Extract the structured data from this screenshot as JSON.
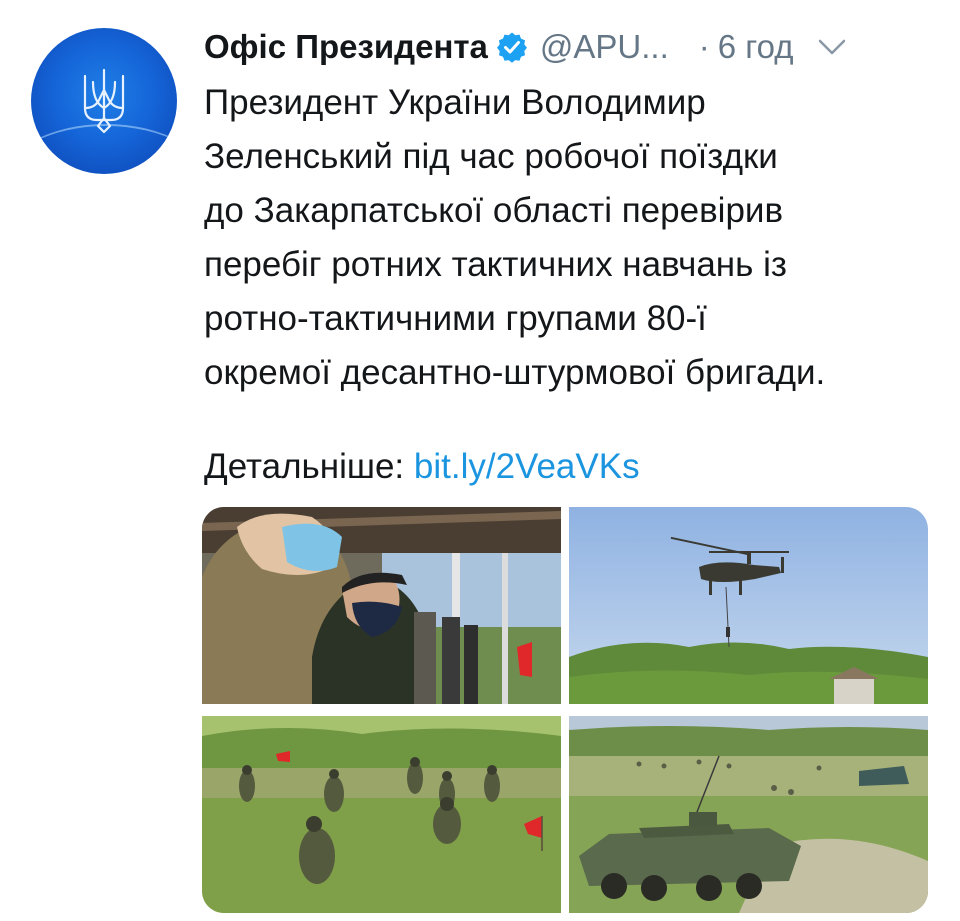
{
  "tweet": {
    "display_name": "Офіс Президента",
    "handle": "@APU...",
    "separator": "·",
    "time": "6 год",
    "text_lines": [
      "Президент України Володимир",
      "Зеленський під час робочої поїздки",
      "до Закарпатської області перевірив",
      "перебіг ротних тактичних навчань із",
      "ротно-тактичними групами 80-ї",
      "окремої десантно-штурмової бригади."
    ],
    "more_label": "Детальніше:",
    "link_text": "bit.ly/2VeaVKs"
  },
  "icons": {
    "avatar": "trident-logo",
    "verified": "verified-badge-icon",
    "menu": "chevron-down-icon"
  },
  "colors": {
    "text": "#14171a",
    "secondary": "#657786",
    "link": "#1b95e0",
    "verified": "#1da1f2",
    "avatar_blue": "#1565d8"
  },
  "media": {
    "count": 4,
    "photos": [
      "officials-watching-exercise-photo",
      "helicopter-rappel-photo",
      "soldiers-advancing-field-photo",
      "armored-vehicle-field-photo"
    ]
  }
}
